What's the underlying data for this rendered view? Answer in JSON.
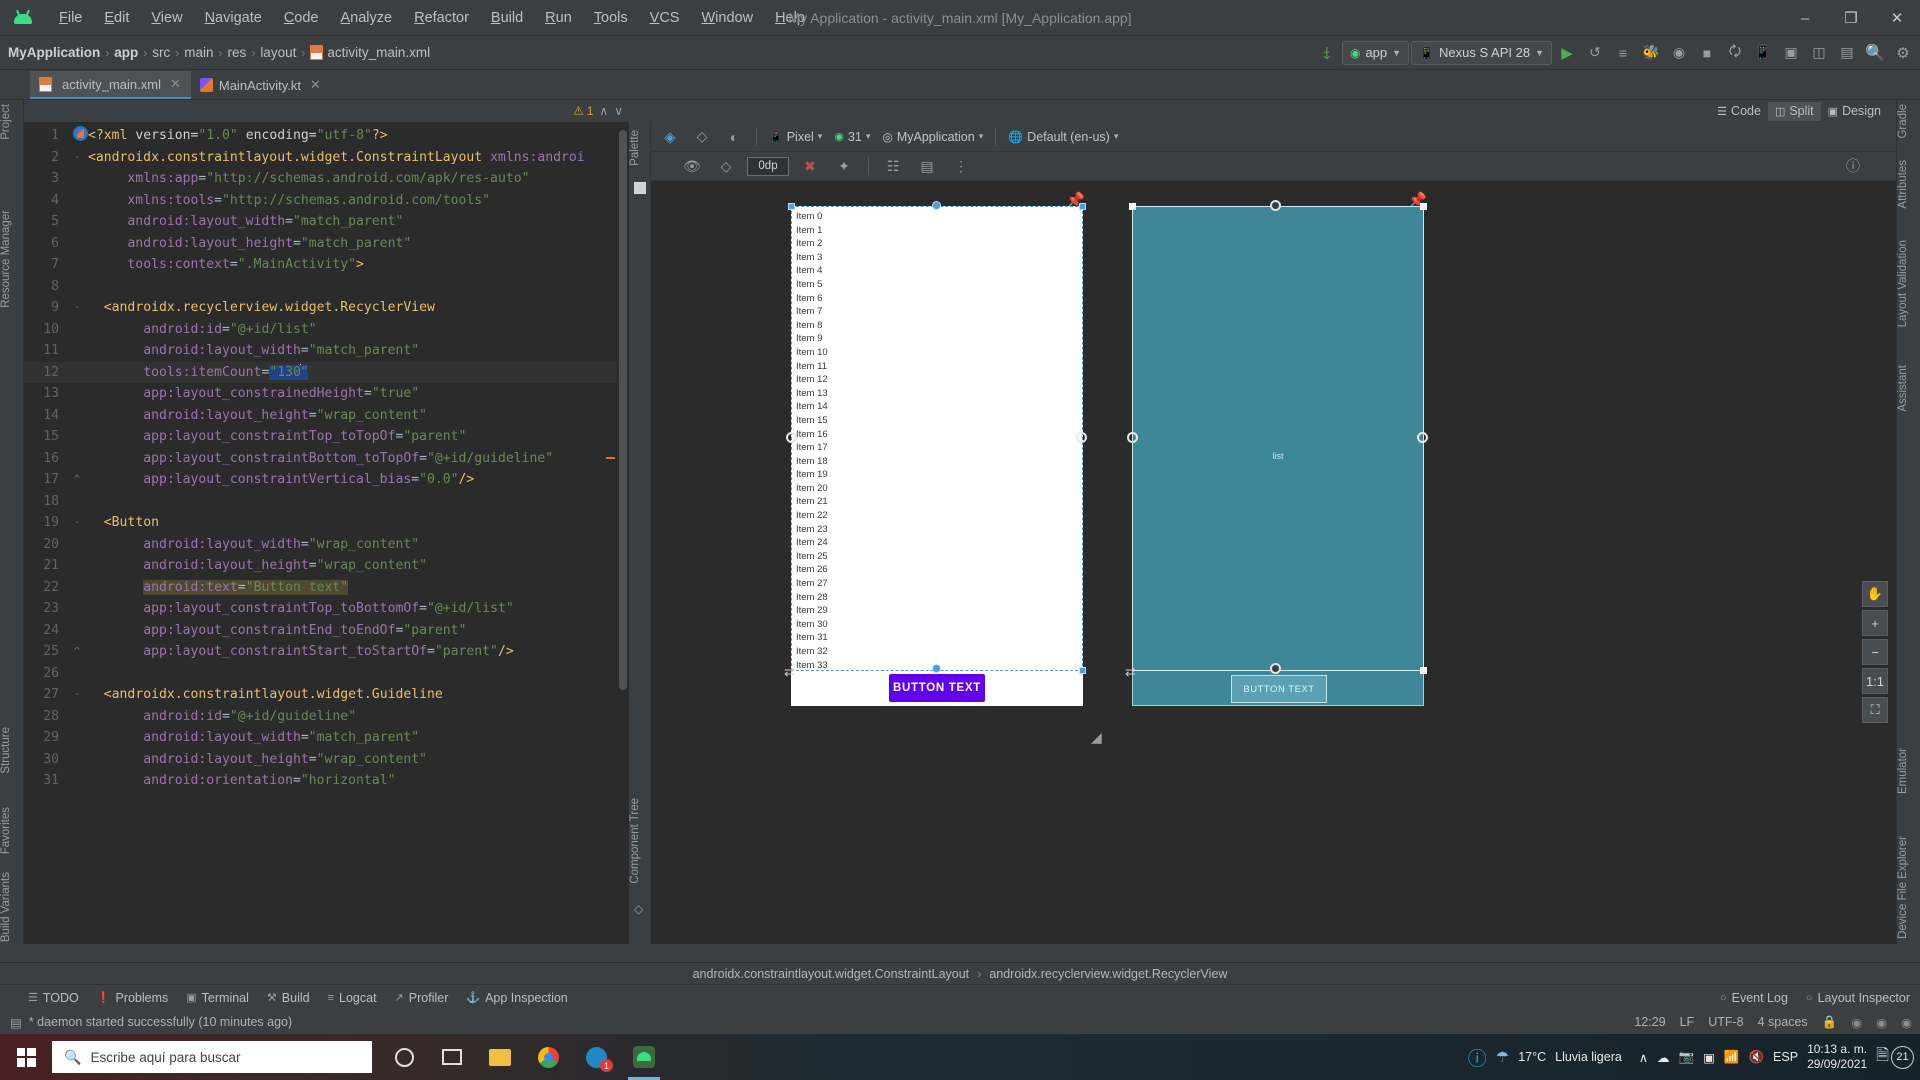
{
  "window": {
    "title": "My Application - activity_main.xml [My_Application.app]",
    "minimize": "–",
    "maximize": "❐",
    "close": "✕"
  },
  "menu": [
    {
      "label": "File"
    },
    {
      "label": "Edit"
    },
    {
      "label": "View"
    },
    {
      "label": "Navigate"
    },
    {
      "label": "Code"
    },
    {
      "label": "Analyze"
    },
    {
      "label": "Refactor"
    },
    {
      "label": "Build"
    },
    {
      "label": "Run"
    },
    {
      "label": "Tools"
    },
    {
      "label": "VCS"
    },
    {
      "label": "Window"
    },
    {
      "label": "Help"
    }
  ],
  "breadcrumb": {
    "items": [
      "MyApplication",
      "app",
      "src",
      "main",
      "res",
      "layout",
      "activity_main.xml"
    ],
    "separator": "›"
  },
  "toolbar": {
    "module_selector": "app",
    "device_selector": "Nexus S API 28",
    "run_label": "▶",
    "icons": [
      "hammer-icon",
      "run-icon",
      "apply-changes-icon",
      "apply-code-changes-icon",
      "debug-icon",
      "profile-icon",
      "stop-icon",
      "avd-manager-icon",
      "sdk-manager-icon",
      "layout-inspector-icon",
      "search-icon",
      "settings-icon"
    ]
  },
  "tabs": [
    {
      "label": "activity_main.xml",
      "active": true,
      "icon": "xml-file-icon"
    },
    {
      "label": "MainActivity.kt",
      "active": false,
      "icon": "kotlin-file-icon"
    }
  ],
  "left_strip": [
    "Project",
    "Resource Manager"
  ],
  "left_strip_bottom": [
    "Structure",
    "Favorites",
    "Build Variants"
  ],
  "right_strip": [
    "Gradle",
    "Attributes",
    "Layout Validation",
    "Assistant"
  ],
  "right_strip_bottom": [
    "Emulator",
    "Device File Explorer"
  ],
  "editor": {
    "warning_count": "1",
    "warning_icon": "warning-triangle-icon",
    "up_icon": "∧",
    "down_icon": "∨",
    "lines": [
      {
        "n": "1",
        "fold": "",
        "html": "<span class='k-pi'>&lt;?xml </span><span class='k-name'>version=</span><span class='k-str'>\"1.0\"</span><span class='k-name'> encoding=</span><span class='k-str'>\"utf-8\"</span><span class='k-pi'>?&gt;</span>"
      },
      {
        "n": "2",
        "fold": "-",
        "html": "<span class='k-tag'>&lt;androidx.constraintlayout.widget.ConstraintLayout </span><span class='k-ns'>xmlns:androi</span>"
      },
      {
        "n": "3",
        "fold": "",
        "html": "     <span class='k-ns'>xmlns:app</span><span class='k-punc'>=</span><span class='k-str'>\"http://schemas.android.com/apk/res-auto\"</span>"
      },
      {
        "n": "4",
        "fold": "",
        "html": "     <span class='k-ns'>xmlns:tools</span><span class='k-punc'>=</span><span class='k-str'>\"http://schemas.android.com/tools\"</span>"
      },
      {
        "n": "5",
        "fold": "",
        "html": "     <span class='k-attr'>android:layout_width</span><span class='k-punc'>=</span><span class='k-str'>\"match_parent\"</span>"
      },
      {
        "n": "6",
        "fold": "",
        "html": "     <span class='k-attr'>android:layout_height</span><span class='k-punc'>=</span><span class='k-str'>\"match_parent\"</span>"
      },
      {
        "n": "7",
        "fold": "",
        "html": "     <span class='k-attr'>tools:context</span><span class='k-punc'>=</span><span class='k-str'>\".MainActivity\"</span><span class='k-tag'>&gt;</span>"
      },
      {
        "n": "8",
        "fold": "",
        "html": ""
      },
      {
        "n": "9",
        "fold": "-",
        "html": "  <span class='k-tag'>&lt;androidx.recyclerview.widget.RecyclerView</span>"
      },
      {
        "n": "10",
        "fold": "",
        "html": "       <span class='k-attr'>android:id</span><span class='k-punc'>=</span><span class='k-str'>\"@+id/list\"</span>"
      },
      {
        "n": "11",
        "fold": "",
        "html": "       <span class='k-attr'>android:layout_width</span><span class='k-punc'>=</span><span class='k-str'>\"match_parent\"</span>"
      },
      {
        "n": "12",
        "fold": "",
        "cur": true,
        "html": "       <span class='k-attr'>tools:itemCount</span><span class='k-punc'>=</span><span class='sel'><span class='k-str'>\"130</span></span><span class='caretbar'></span><span class='sel'><span class='k-str'>\"</span></span>"
      },
      {
        "n": "13",
        "fold": "",
        "html": "       <span class='k-attr'>app:layout_constrainedHeight</span><span class='k-punc'>=</span><span class='k-str'>\"true\"</span>"
      },
      {
        "n": "14",
        "fold": "",
        "html": "       <span class='k-attr'>android:layout_height</span><span class='k-punc'>=</span><span class='k-str'>\"wrap_content\"</span>"
      },
      {
        "n": "15",
        "fold": "",
        "html": "       <span class='k-attr'>app:layout_constraintTop_toTopOf</span><span class='k-punc'>=</span><span class='k-str'>\"parent\"</span>"
      },
      {
        "n": "16",
        "fold": "",
        "html": "       <span class='k-attr'>app:layout_constraintBottom_toTopOf</span><span class='k-punc'>=</span><span class='k-str'>\"@+id/guideline\"</span>"
      },
      {
        "n": "17",
        "fold": "^",
        "html": "       <span class='k-attr'>app:layout_constraintVertical_bias</span><span class='k-punc'>=</span><span class='k-str'>\"0.0\"</span><span class='k-tag'>/&gt;</span>"
      },
      {
        "n": "18",
        "fold": "",
        "html": ""
      },
      {
        "n": "19",
        "fold": "-",
        "html": "  <span class='k-tag'>&lt;Button</span>"
      },
      {
        "n": "20",
        "fold": "",
        "html": "       <span class='k-attr'>android:layout_width</span><span class='k-punc'>=</span><span class='k-str'>\"wrap_content\"</span>"
      },
      {
        "n": "21",
        "fold": "",
        "html": "       <span class='k-attr'>android:layout_height</span><span class='k-punc'>=</span><span class='k-str'>\"wrap_content\"</span>"
      },
      {
        "n": "22",
        "fold": "",
        "html": "       <span class='hl-line'><span class='k-attr'>android:text</span><span class='k-punc'>=</span><span class='k-str'>\"Button text\"</span></span>"
      },
      {
        "n": "23",
        "fold": "",
        "html": "       <span class='k-attr'>app:layout_constraintTop_toBottomOf</span><span class='k-punc'>=</span><span class='k-str'>\"@+id/list\"</span>"
      },
      {
        "n": "24",
        "fold": "",
        "html": "       <span class='k-attr'>app:layout_constraintEnd_toEndOf</span><span class='k-punc'>=</span><span class='k-str'>\"parent\"</span>"
      },
      {
        "n": "25",
        "fold": "^",
        "html": "       <span class='k-attr'>app:layout_constraintStart_toStartOf</span><span class='k-punc'>=</span><span class='k-str'>\"parent\"</span><span class='k-tag'>/&gt;</span>"
      },
      {
        "n": "26",
        "fold": "",
        "html": ""
      },
      {
        "n": "27",
        "fold": "-",
        "html": "  <span class='k-tag'>&lt;androidx.constraintlayout.widget.Guideline</span>"
      },
      {
        "n": "28",
        "fold": "",
        "html": "       <span class='k-attr'>android:id</span><span class='k-punc'>=</span><span class='k-str'>\"@+id/guideline\"</span>"
      },
      {
        "n": "29",
        "fold": "",
        "html": "       <span class='k-attr'>android:layout_width</span><span class='k-punc'>=</span><span class='k-str'>\"match_parent\"</span>"
      },
      {
        "n": "30",
        "fold": "",
        "html": "       <span class='k-attr'>android:layout_height</span><span class='k-punc'>=</span><span class='k-str'>\"wrap_content\"</span>"
      },
      {
        "n": "31",
        "fold": "",
        "html": "       <span class='k-attr'>android:orientation</span><span class='k-punc'>=</span><span class='k-str'>\"horizontal\"</span>"
      }
    ]
  },
  "design": {
    "view_modes": [
      {
        "label": "Code",
        "icon": "code-view-icon",
        "active": false
      },
      {
        "label": "Split",
        "icon": "split-view-icon",
        "active": true
      },
      {
        "label": "Design",
        "icon": "design-view-icon",
        "active": false
      }
    ],
    "palette_label": "Palette",
    "component_tree_label": "Component Tree",
    "toolbar": {
      "design_surface": "layers-icon",
      "orientation": "rotate-icon",
      "theme": "theme-icon",
      "device": "Pixel",
      "api_level": "31",
      "theme_name": "MyApplication",
      "locale": "Default (en-us)"
    },
    "toolbar2": {
      "eye_icon": "visibility-icon",
      "blueprint_toggle": "blueprint-icon",
      "margin_value": "0dp",
      "clear_constraints": "clear-constraints-icon",
      "infer_constraints": "infer-constraints-icon",
      "pack_icon": "pack-icon",
      "align_icon": "align-icon",
      "guidelines_icon": "guidelines-icon",
      "help_icon": "help-icon"
    },
    "canvas_tools": [
      {
        "name": "pan-tool",
        "glyph": "✋"
      },
      {
        "name": "zoom-in",
        "glyph": "+"
      },
      {
        "name": "zoom-out",
        "glyph": "−"
      },
      {
        "name": "zoom-actual",
        "glyph": "1:1"
      },
      {
        "name": "zoom-fit",
        "glyph": "⛶"
      }
    ],
    "preview": {
      "list_id": "list",
      "button_text": "BUTTON TEXT",
      "item_prefix": "Item ",
      "item_count": 34
    }
  },
  "bottom_breadcrumb": {
    "parent": "androidx.constraintlayout.widget.ConstraintLayout",
    "separator": "›",
    "child": "androidx.recyclerview.widget.RecyclerView"
  },
  "tool_windows": [
    {
      "label": "TODO",
      "icon": "todo-icon"
    },
    {
      "label": "Problems",
      "icon": "problems-icon"
    },
    {
      "label": "Terminal",
      "icon": "terminal-icon"
    },
    {
      "label": "Build",
      "icon": "build-hammer-icon"
    },
    {
      "label": "Logcat",
      "icon": "logcat-icon"
    },
    {
      "label": "Profiler",
      "icon": "profiler-icon"
    },
    {
      "label": "App Inspection",
      "icon": "app-inspection-icon"
    }
  ],
  "tool_windows_right": [
    {
      "label": "Event Log",
      "icon": "event-log-icon"
    },
    {
      "label": "Layout Inspector",
      "icon": "layout-inspector-icon"
    }
  ],
  "status": {
    "message": "* daemon started successfully (10 minutes ago)",
    "caret_position": "12:29",
    "line_separator": "LF",
    "encoding": "UTF-8",
    "indent": "4 spaces",
    "lock_icon": "lock-icon",
    "inspection_icon": "inspection-icon",
    "notification_icon": "notification-icon",
    "avatar_icon": "avatar-icon"
  },
  "taskbar": {
    "search_placeholder": "Escribe aquí para buscar",
    "search_icon": "search-icon",
    "cortana_icon": "cortana-circle-icon",
    "taskview_icon": "task-view-icon",
    "apps": [
      {
        "name": "file-explorer-icon"
      },
      {
        "name": "chrome-icon"
      },
      {
        "name": "messaging-icon",
        "badge": "1"
      },
      {
        "name": "android-studio-icon",
        "active": true
      }
    ],
    "tray": {
      "help_icon": "help-circle-icon",
      "weather_icon": "rain-cloud-icon",
      "temperature": "17°C",
      "weather_text": "Lluvia ligera",
      "chevron": "∧",
      "onedrive_icon": "onedrive-icon",
      "device_icon": "device-icon",
      "battery_icon": "battery-icon",
      "wifi_icon": "wifi-icon",
      "volume_icon": "volume-muted-icon",
      "language": "ESP",
      "time": "10:13 a. m.",
      "date": "29/09/2021",
      "notification_count": "21"
    }
  },
  "colors": {
    "accent": "#4a88c7",
    "android_green": "#3ddc84",
    "button_purple": "#6200ee",
    "blueprint": "#3e8799",
    "editor_bg": "#2b2b2b",
    "chrome_bg": "#3c3f41"
  }
}
